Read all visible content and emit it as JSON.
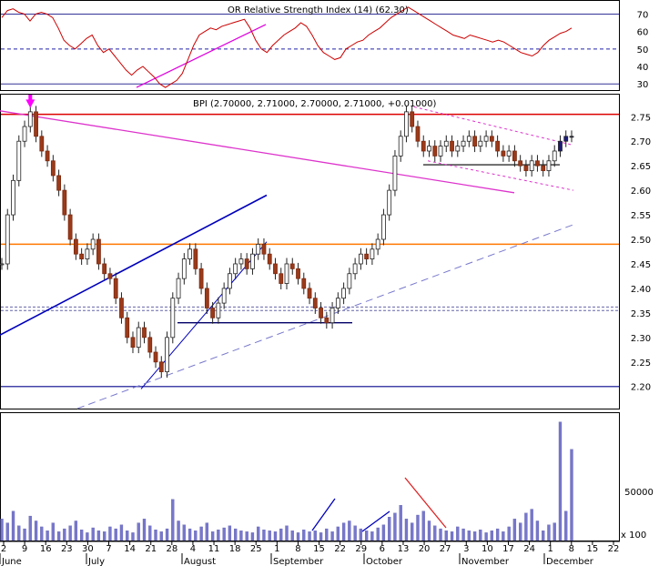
{
  "chart_data": [
    {
      "type": "line",
      "panel": "rsi",
      "title": "OR Relative Strength Index (14) (62.30)",
      "ytick_labels": [
        "70",
        "60",
        "50",
        "40",
        "30"
      ],
      "yticks": [
        70,
        60,
        50,
        40,
        30
      ],
      "ylim": [
        27,
        77
      ],
      "reference_levels": [
        70,
        50,
        30
      ],
      "series": [
        {
          "values": [
            68,
            72,
            73,
            71,
            70,
            66,
            70,
            71,
            70,
            68,
            62,
            55,
            52,
            50,
            53,
            56,
            58,
            52,
            48,
            50,
            46,
            42,
            38,
            35,
            38,
            40,
            37,
            34,
            30,
            28,
            30,
            32,
            36,
            44,
            52,
            58,
            60,
            62,
            61,
            63,
            64,
            65,
            66,
            67,
            62,
            55,
            50,
            48,
            52,
            55,
            58,
            60,
            62,
            65,
            63,
            58,
            52,
            48,
            46,
            44,
            45,
            50,
            52,
            54,
            55,
            58,
            60,
            62,
            65,
            68,
            70,
            72,
            74,
            72,
            70,
            68,
            66,
            64,
            62,
            60,
            58,
            57,
            56,
            58,
            57,
            56,
            55,
            54,
            55,
            54,
            52,
            50,
            48,
            47,
            46,
            48,
            52,
            55,
            57,
            59,
            60,
            62
          ]
        }
      ],
      "trendline_color": "#dd00dd"
    },
    {
      "type": "candlestick",
      "panel": "price",
      "title": "BPI (2.70000, 2.71000, 2.70000, 2.71000, +0.01000)",
      "ytick_labels": [
        "2.75",
        "2.70",
        "2.65",
        "2.60",
        "2.55",
        "2.50",
        "2.45",
        "2.40",
        "2.35",
        "2.30",
        "2.25",
        "2.20"
      ],
      "yticks": [
        2.75,
        2.7,
        2.65,
        2.6,
        2.55,
        2.5,
        2.45,
        2.4,
        2.35,
        2.3,
        2.25,
        2.2
      ],
      "ylim": [
        2.155,
        2.795
      ],
      "horizontal_levels": [
        {
          "value": 2.755,
          "color": "#dd0000"
        },
        {
          "value": 2.49,
          "color": "#ff7700"
        },
        {
          "value": 2.2,
          "color": "#4444aa"
        },
        {
          "value": 2.362,
          "color": "#6666aa",
          "style": "dashed"
        },
        {
          "value": 2.355,
          "color": "#6666aa",
          "style": "dashed"
        }
      ],
      "closes": [
        2.45,
        2.55,
        2.62,
        2.7,
        2.73,
        2.76,
        2.71,
        2.68,
        2.66,
        2.63,
        2.6,
        2.55,
        2.5,
        2.47,
        2.46,
        2.48,
        2.5,
        2.45,
        2.43,
        2.42,
        2.38,
        2.34,
        2.3,
        2.28,
        2.32,
        2.3,
        2.27,
        2.25,
        2.23,
        2.3,
        2.38,
        2.42,
        2.46,
        2.48,
        2.44,
        2.4,
        2.36,
        2.34,
        2.37,
        2.4,
        2.43,
        2.45,
        2.46,
        2.44,
        2.47,
        2.49,
        2.47,
        2.45,
        2.43,
        2.41,
        2.45,
        2.44,
        2.42,
        2.4,
        2.38,
        2.36,
        2.34,
        2.33,
        2.36,
        2.38,
        2.4,
        2.43,
        2.45,
        2.47,
        2.46,
        2.48,
        2.5,
        2.55,
        2.6,
        2.67,
        2.71,
        2.76,
        2.73,
        2.7,
        2.68,
        2.69,
        2.67,
        2.69,
        2.7,
        2.68,
        2.69,
        2.7,
        2.71,
        2.69,
        2.7,
        2.71,
        2.7,
        2.68,
        2.67,
        2.68,
        2.66,
        2.65,
        2.64,
        2.66,
        2.65,
        2.64,
        2.66,
        2.68,
        2.7,
        2.71,
        2.71
      ],
      "marker": {
        "shape": "arrow-down",
        "color": "#ff00ff"
      }
    },
    {
      "type": "bar",
      "panel": "volume",
      "ytick_labels": [
        "50000"
      ],
      "yticks": [
        50000
      ],
      "ylim": [
        0,
        130000
      ],
      "scale_label": "x 100",
      "values": [
        22000,
        18000,
        30000,
        15000,
        12000,
        25000,
        20000,
        14000,
        10000,
        18000,
        9000,
        12000,
        15000,
        20000,
        11000,
        8000,
        13000,
        10000,
        9000,
        14000,
        12000,
        16000,
        10000,
        8000,
        18000,
        22000,
        15000,
        11000,
        9000,
        12000,
        42000,
        20000,
        16000,
        12000,
        10000,
        14000,
        18000,
        9000,
        11000,
        13000,
        15000,
        12000,
        10000,
        9000,
        8000,
        14000,
        11000,
        10000,
        9000,
        12000,
        15000,
        10000,
        8000,
        11000,
        9000,
        10000,
        8000,
        12000,
        9000,
        14000,
        18000,
        20000,
        15000,
        12000,
        10000,
        9000,
        13000,
        16000,
        24000,
        28000,
        36000,
        22000,
        18000,
        26000,
        30000,
        20000,
        15000,
        12000,
        10000,
        9000,
        14000,
        12000,
        10000,
        9000,
        11000,
        8000,
        10000,
        12000,
        9000,
        14000,
        22000,
        18000,
        28000,
        32000,
        20000,
        10000,
        16000,
        18000,
        121000,
        30000,
        93000
      ]
    }
  ],
  "x_axis": {
    "tick_labels": [
      "2",
      "9",
      "16",
      "23",
      "30",
      "7",
      "14",
      "21",
      "28",
      "4",
      "11",
      "18",
      "25",
      "1",
      "8",
      "15",
      "22",
      "29",
      "6",
      "13",
      "20",
      "27",
      "3",
      "10",
      "17",
      "24",
      "1",
      "8",
      "15",
      "22"
    ],
    "month_labels": [
      "June",
      "July",
      "August",
      "September",
      "October",
      "November",
      "December"
    ]
  }
}
